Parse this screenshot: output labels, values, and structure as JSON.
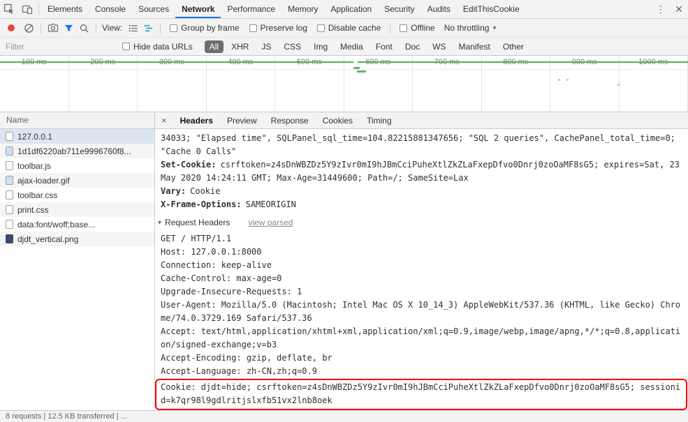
{
  "tabbar": {
    "tabs": [
      "Elements",
      "Console",
      "Sources",
      "Network",
      "Performance",
      "Memory",
      "Application",
      "Security",
      "Audits",
      "EditThisCookie"
    ],
    "active": "Network"
  },
  "toolbar": {
    "view_label": "View:",
    "group_by_frame": "Group by frame",
    "preserve_log": "Preserve log",
    "disable_cache": "Disable cache",
    "offline": "Offline",
    "throttling": "No throttling"
  },
  "filterbar": {
    "placeholder": "Filter",
    "hide_data_urls": "Hide data URLs",
    "pills": [
      "All",
      "XHR",
      "JS",
      "CSS",
      "Img",
      "Media",
      "Font",
      "Doc",
      "WS",
      "Manifest",
      "Other"
    ],
    "active_pill": "All"
  },
  "timeline": {
    "ticks": [
      "100 ms",
      "200 ms",
      "300 ms",
      "400 ms",
      "500 ms",
      "600 ms",
      "700 ms",
      "800 ms",
      "900 ms",
      "1000 ms"
    ]
  },
  "sidebar": {
    "header": "Name",
    "rows": [
      {
        "name": "127.0.0.1",
        "icon": "document",
        "selected": true
      },
      {
        "name": "1d1df6220ab711e9996760f8...",
        "icon": "image"
      },
      {
        "name": "toolbar.js",
        "icon": "script"
      },
      {
        "name": "ajax-loader.gif",
        "icon": "image"
      },
      {
        "name": "toolbar.css",
        "icon": "stylesheet"
      },
      {
        "name": "print.css",
        "icon": "stylesheet"
      },
      {
        "name": "data:font/woff;base...",
        "icon": "font"
      },
      {
        "name": "djdt_vertical.png",
        "icon": "image-dark"
      }
    ]
  },
  "details": {
    "close": "×",
    "tabs": [
      "Headers",
      "Preview",
      "Response",
      "Cookies",
      "Timing"
    ],
    "active": "Headers",
    "overflow_value": "34033; \"Elapsed time\", SQLPanel_sql_time=104.82215881347656; \"SQL 2 queries\", CachePanel_total_time=0; \"Cache 0 Calls\"",
    "headers": [
      {
        "name": "Set-Cookie:",
        "value": "csrftoken=z4sDnWBZDz5Y9zIvr0mI9hJBmCciPuheXtlZkZLaFxepDfvo0Dnrj0zoOaMF8sG5; expires=Sat, 23 May 2020 14:24:11 GMT; Max-Age=31449600; Path=/; SameSite=Lax"
      },
      {
        "name": "Vary:",
        "value": "Cookie"
      },
      {
        "name": "X-Frame-Options:",
        "value": "SAMEORIGIN"
      }
    ],
    "section": {
      "label": "Request Headers",
      "action": "view parsed"
    },
    "raw": [
      "GET / HTTP/1.1",
      "Host: 127.0.0.1:8000",
      "Connection: keep-alive",
      "Cache-Control: max-age=0",
      "Upgrade-Insecure-Requests: 1",
      "User-Agent: Mozilla/5.0 (Macintosh; Intel Mac OS X 10_14_3) AppleWebKit/537.36 (KHTML, like Gecko) Chrome/74.0.3729.169 Safari/537.36",
      "Accept: text/html,application/xhtml+xml,application/xml;q=0.9,image/webp,image/apng,*/*;q=0.8,application/signed-exchange;v=b3",
      "Accept-Encoding: gzip, deflate, br",
      "Accept-Language: zh-CN,zh;q=0.9"
    ],
    "cookie": "Cookie: djdt=hide; csrftoken=z4sDnWBZDz5Y9zIvr0mI9hJBmCciPuheXtlZkZLaFxepDfvo0Dnrj0zoOaMF8sG5; sessionid=k7qr98l9gdlritjslxfb51vx2lnb8oek"
  },
  "statusbar": {
    "text": "8 requests | 12.5 KB transferred | ..."
  },
  "icons": {
    "kebab": "⋮",
    "close": "✕",
    "caret": "▾",
    "disclosure": "▾"
  },
  "colors": {
    "accent": "#1a73e8",
    "record": "#ea4335",
    "highlight": "#ff0000",
    "pill_active_bg": "#6e6e6e",
    "timeline_green": "#4db34d",
    "selected_row_bg": "#dce6f2"
  }
}
